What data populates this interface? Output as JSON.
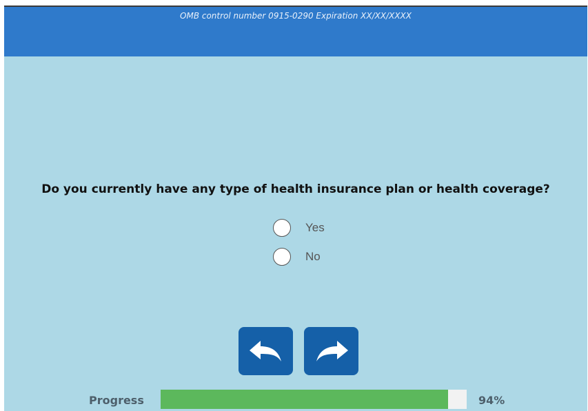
{
  "header": {
    "omb_text": "OMB control number 0915-0290 Expiration XX/XX/XXXX"
  },
  "question": {
    "text": "Do you currently have any type of health insurance plan or health coverage?",
    "options": [
      {
        "label": "Yes",
        "selected": false
      },
      {
        "label": "No",
        "selected": false
      }
    ]
  },
  "navigation": {
    "back_icon": "back-arrow-icon",
    "forward_icon": "forward-arrow-icon"
  },
  "progress": {
    "label": "Progress",
    "value": 94,
    "text": "94%"
  },
  "colors": {
    "header": "#2f7acb",
    "background": "#add8e6",
    "button": "#1560a8",
    "progress_fill": "#5cb85c"
  }
}
